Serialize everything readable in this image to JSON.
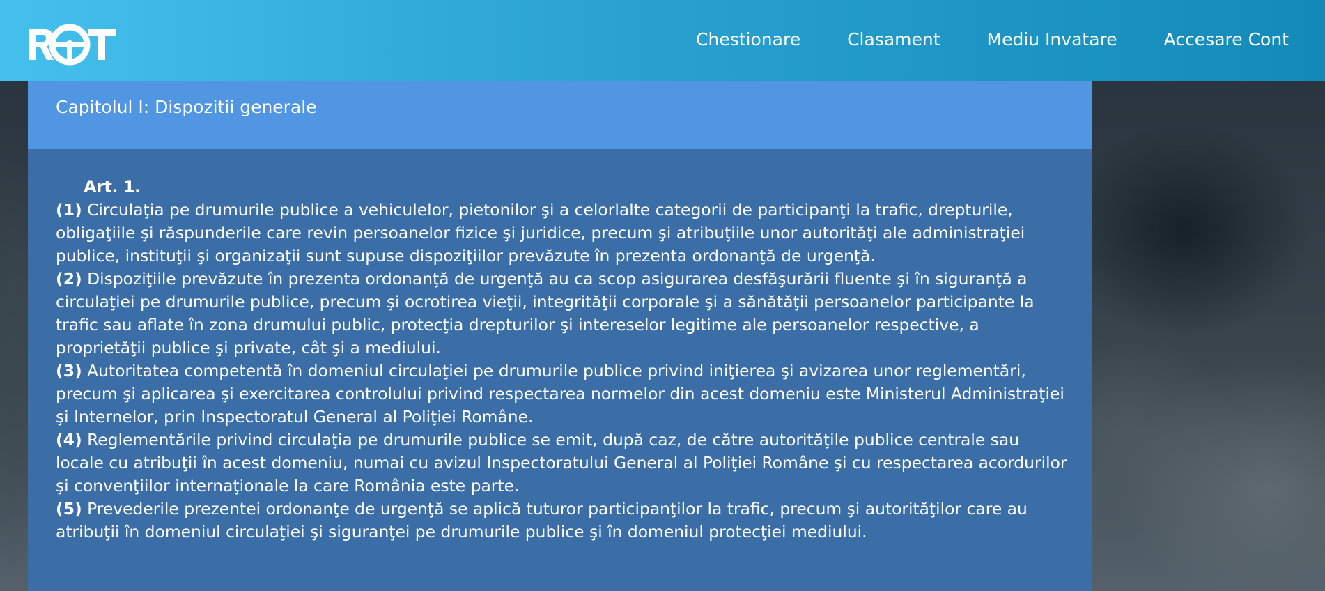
{
  "header": {
    "logo_text": "ROT",
    "nav": [
      {
        "label": "Chestionare"
      },
      {
        "label": "Clasament"
      },
      {
        "label": "Mediu Invatare"
      },
      {
        "label": "Accesare Cont"
      }
    ]
  },
  "chapter": {
    "title": "Capitolul I: Dispozitii generale"
  },
  "article": {
    "title": "Art. 1.",
    "paragraphs": [
      {
        "num": "(1)",
        "text": " Circulaţia pe drumurile publice a vehiculelor, pietonilor şi a celorlalte categorii de participanţi la trafic, drepturile, obligaţiile şi răspunderile care revin persoanelor fizice şi juridice, precum şi atribuţiile unor autorităţi ale administraţiei publice, instituţii şi organizaţii sunt supuse dispoziţiilor prevăzute în prezenta ordonanţă de urgenţă."
      },
      {
        "num": "(2)",
        "text": " Dispoziţiile prevăzute în prezenta ordonanţă de urgenţă au ca scop asigurarea desfăşurării fluente şi în siguranţă a circulaţiei pe drumurile publice, precum şi ocrotirea vieţii, integrităţii corporale şi a sănătăţii persoanelor participante la trafic sau aflate în zona drumului public, protecţia drepturilor şi intereselor legitime ale persoanelor respective, a proprietăţii publice şi private, cât şi a mediului."
      },
      {
        "num": "(3)",
        "text": " Autoritatea competentă în domeniul circulaţiei pe drumurile publice privind iniţierea şi avizarea unor reglementări, precum şi aplicarea şi exercitarea controlului privind respectarea normelor din acest domeniu este Ministerul Administraţiei şi Internelor, prin Inspectoratul General al Poliţiei Române."
      },
      {
        "num": "(4)",
        "text": " Reglementările privind circulaţia pe drumurile publice se emit, după caz, de către autorităţile publice centrale sau locale cu atribuţii în acest domeniu, numai cu avizul Inspectoratului General al Poliţiei Române şi cu respectarea acordurilor şi convenţiilor internaţionale la care România este parte."
      },
      {
        "num": "(5)",
        "text": " Prevederile prezentei ordonanţe de urgenţă se aplică tuturor participanţilor la trafic, precum şi autorităţilor care au atribuţii în domeniul circulaţiei şi siguranţei pe drumurile publice şi în domeniul protecţiei mediului."
      }
    ]
  },
  "colors": {
    "header_gradient_start": "#45c0ec",
    "header_gradient_end": "#138ab8",
    "chapter_bar": "#5196e3",
    "article_body": "#3b6ea6",
    "text": "#ffffff"
  },
  "icons": {
    "logo": "steering-wheel-icon"
  }
}
